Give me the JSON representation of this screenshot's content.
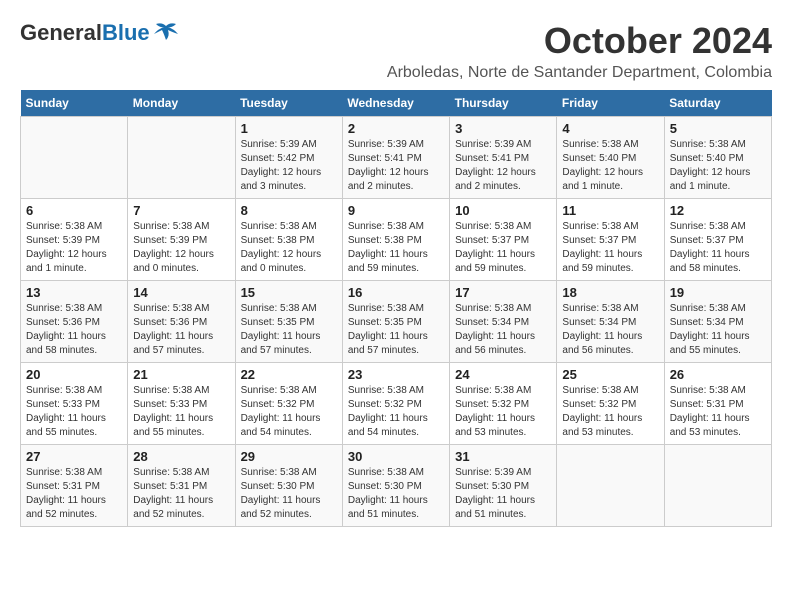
{
  "header": {
    "logo_general": "General",
    "logo_blue": "Blue",
    "month_title": "October 2024",
    "location": "Arboledas, Norte de Santander Department, Colombia"
  },
  "weekdays": [
    "Sunday",
    "Monday",
    "Tuesday",
    "Wednesday",
    "Thursday",
    "Friday",
    "Saturday"
  ],
  "weeks": [
    [
      {
        "day": "",
        "detail": ""
      },
      {
        "day": "",
        "detail": ""
      },
      {
        "day": "1",
        "detail": "Sunrise: 5:39 AM\nSunset: 5:42 PM\nDaylight: 12 hours and 3 minutes."
      },
      {
        "day": "2",
        "detail": "Sunrise: 5:39 AM\nSunset: 5:41 PM\nDaylight: 12 hours and 2 minutes."
      },
      {
        "day": "3",
        "detail": "Sunrise: 5:39 AM\nSunset: 5:41 PM\nDaylight: 12 hours and 2 minutes."
      },
      {
        "day": "4",
        "detail": "Sunrise: 5:38 AM\nSunset: 5:40 PM\nDaylight: 12 hours and 1 minute."
      },
      {
        "day": "5",
        "detail": "Sunrise: 5:38 AM\nSunset: 5:40 PM\nDaylight: 12 hours and 1 minute."
      }
    ],
    [
      {
        "day": "6",
        "detail": "Sunrise: 5:38 AM\nSunset: 5:39 PM\nDaylight: 12 hours and 1 minute."
      },
      {
        "day": "7",
        "detail": "Sunrise: 5:38 AM\nSunset: 5:39 PM\nDaylight: 12 hours and 0 minutes."
      },
      {
        "day": "8",
        "detail": "Sunrise: 5:38 AM\nSunset: 5:38 PM\nDaylight: 12 hours and 0 minutes."
      },
      {
        "day": "9",
        "detail": "Sunrise: 5:38 AM\nSunset: 5:38 PM\nDaylight: 11 hours and 59 minutes."
      },
      {
        "day": "10",
        "detail": "Sunrise: 5:38 AM\nSunset: 5:37 PM\nDaylight: 11 hours and 59 minutes."
      },
      {
        "day": "11",
        "detail": "Sunrise: 5:38 AM\nSunset: 5:37 PM\nDaylight: 11 hours and 59 minutes."
      },
      {
        "day": "12",
        "detail": "Sunrise: 5:38 AM\nSunset: 5:37 PM\nDaylight: 11 hours and 58 minutes."
      }
    ],
    [
      {
        "day": "13",
        "detail": "Sunrise: 5:38 AM\nSunset: 5:36 PM\nDaylight: 11 hours and 58 minutes."
      },
      {
        "day": "14",
        "detail": "Sunrise: 5:38 AM\nSunset: 5:36 PM\nDaylight: 11 hours and 57 minutes."
      },
      {
        "day": "15",
        "detail": "Sunrise: 5:38 AM\nSunset: 5:35 PM\nDaylight: 11 hours and 57 minutes."
      },
      {
        "day": "16",
        "detail": "Sunrise: 5:38 AM\nSunset: 5:35 PM\nDaylight: 11 hours and 57 minutes."
      },
      {
        "day": "17",
        "detail": "Sunrise: 5:38 AM\nSunset: 5:34 PM\nDaylight: 11 hours and 56 minutes."
      },
      {
        "day": "18",
        "detail": "Sunrise: 5:38 AM\nSunset: 5:34 PM\nDaylight: 11 hours and 56 minutes."
      },
      {
        "day": "19",
        "detail": "Sunrise: 5:38 AM\nSunset: 5:34 PM\nDaylight: 11 hours and 55 minutes."
      }
    ],
    [
      {
        "day": "20",
        "detail": "Sunrise: 5:38 AM\nSunset: 5:33 PM\nDaylight: 11 hours and 55 minutes."
      },
      {
        "day": "21",
        "detail": "Sunrise: 5:38 AM\nSunset: 5:33 PM\nDaylight: 11 hours and 55 minutes."
      },
      {
        "day": "22",
        "detail": "Sunrise: 5:38 AM\nSunset: 5:32 PM\nDaylight: 11 hours and 54 minutes."
      },
      {
        "day": "23",
        "detail": "Sunrise: 5:38 AM\nSunset: 5:32 PM\nDaylight: 11 hours and 54 minutes."
      },
      {
        "day": "24",
        "detail": "Sunrise: 5:38 AM\nSunset: 5:32 PM\nDaylight: 11 hours and 53 minutes."
      },
      {
        "day": "25",
        "detail": "Sunrise: 5:38 AM\nSunset: 5:32 PM\nDaylight: 11 hours and 53 minutes."
      },
      {
        "day": "26",
        "detail": "Sunrise: 5:38 AM\nSunset: 5:31 PM\nDaylight: 11 hours and 53 minutes."
      }
    ],
    [
      {
        "day": "27",
        "detail": "Sunrise: 5:38 AM\nSunset: 5:31 PM\nDaylight: 11 hours and 52 minutes."
      },
      {
        "day": "28",
        "detail": "Sunrise: 5:38 AM\nSunset: 5:31 PM\nDaylight: 11 hours and 52 minutes."
      },
      {
        "day": "29",
        "detail": "Sunrise: 5:38 AM\nSunset: 5:30 PM\nDaylight: 11 hours and 52 minutes."
      },
      {
        "day": "30",
        "detail": "Sunrise: 5:38 AM\nSunset: 5:30 PM\nDaylight: 11 hours and 51 minutes."
      },
      {
        "day": "31",
        "detail": "Sunrise: 5:39 AM\nSunset: 5:30 PM\nDaylight: 11 hours and 51 minutes."
      },
      {
        "day": "",
        "detail": ""
      },
      {
        "day": "",
        "detail": ""
      }
    ]
  ]
}
